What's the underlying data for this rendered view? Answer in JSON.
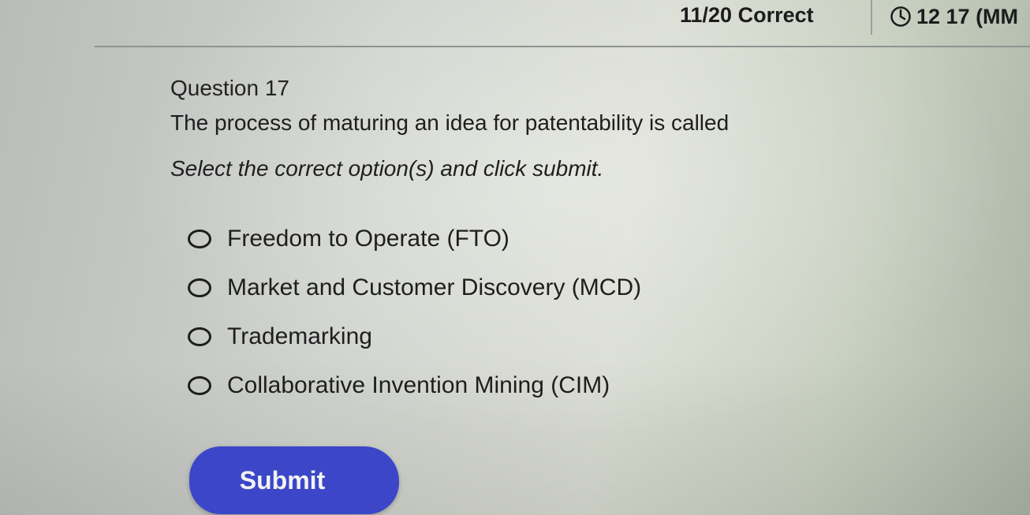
{
  "header": {
    "score_text": "11/20 Correct",
    "timer_text": "12 17 (MM",
    "timer_icon": "clock-icon"
  },
  "question": {
    "title": "Question 17",
    "text": "The process of maturing an idea for patentability is called",
    "instruction": "Select the correct option(s) and click submit."
  },
  "options": [
    {
      "label": "Freedom to Operate (FTO)"
    },
    {
      "label": "Market and Customer Discovery (MCD)"
    },
    {
      "label": "Trademarking"
    },
    {
      "label": "Collaborative Invention Mining (CIM)"
    }
  ],
  "submit": {
    "label": "Submit",
    "color": "#3b47c8"
  }
}
